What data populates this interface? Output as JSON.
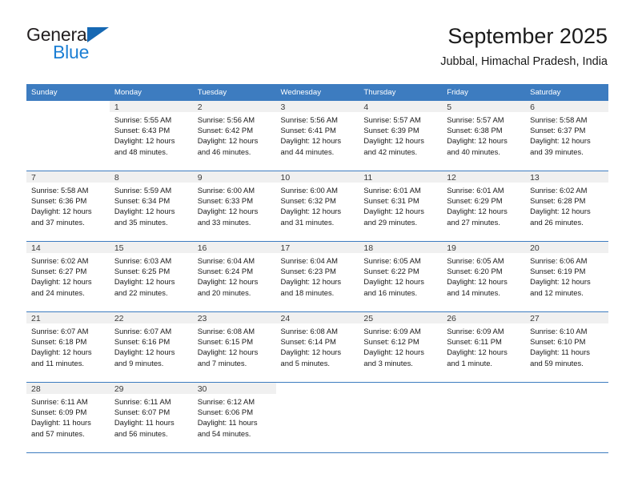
{
  "brand": {
    "line1": "General",
    "line2": "Blue",
    "triangle_color": "#1668b3",
    "line2_color": "#1c7fd4"
  },
  "header": {
    "title": "September 2025",
    "subtitle": "Jubbal, Himachal Pradesh, India"
  },
  "calendar": {
    "header_bg": "#3d7cc0",
    "daynum_bg": "#f0f0f0",
    "weekday_headers": [
      "Sunday",
      "Monday",
      "Tuesday",
      "Wednesday",
      "Thursday",
      "Friday",
      "Saturday"
    ],
    "weeks": [
      [
        {
          "day": "",
          "sunrise": "",
          "sunset": "",
          "daylight1": "",
          "daylight2": ""
        },
        {
          "day": "1",
          "sunrise": "Sunrise: 5:55 AM",
          "sunset": "Sunset: 6:43 PM",
          "daylight1": "Daylight: 12 hours",
          "daylight2": "and 48 minutes."
        },
        {
          "day": "2",
          "sunrise": "Sunrise: 5:56 AM",
          "sunset": "Sunset: 6:42 PM",
          "daylight1": "Daylight: 12 hours",
          "daylight2": "and 46 minutes."
        },
        {
          "day": "3",
          "sunrise": "Sunrise: 5:56 AM",
          "sunset": "Sunset: 6:41 PM",
          "daylight1": "Daylight: 12 hours",
          "daylight2": "and 44 minutes."
        },
        {
          "day": "4",
          "sunrise": "Sunrise: 5:57 AM",
          "sunset": "Sunset: 6:39 PM",
          "daylight1": "Daylight: 12 hours",
          "daylight2": "and 42 minutes."
        },
        {
          "day": "5",
          "sunrise": "Sunrise: 5:57 AM",
          "sunset": "Sunset: 6:38 PM",
          "daylight1": "Daylight: 12 hours",
          "daylight2": "and 40 minutes."
        },
        {
          "day": "6",
          "sunrise": "Sunrise: 5:58 AM",
          "sunset": "Sunset: 6:37 PM",
          "daylight1": "Daylight: 12 hours",
          "daylight2": "and 39 minutes."
        }
      ],
      [
        {
          "day": "7",
          "sunrise": "Sunrise: 5:58 AM",
          "sunset": "Sunset: 6:36 PM",
          "daylight1": "Daylight: 12 hours",
          "daylight2": "and 37 minutes."
        },
        {
          "day": "8",
          "sunrise": "Sunrise: 5:59 AM",
          "sunset": "Sunset: 6:34 PM",
          "daylight1": "Daylight: 12 hours",
          "daylight2": "and 35 minutes."
        },
        {
          "day": "9",
          "sunrise": "Sunrise: 6:00 AM",
          "sunset": "Sunset: 6:33 PM",
          "daylight1": "Daylight: 12 hours",
          "daylight2": "and 33 minutes."
        },
        {
          "day": "10",
          "sunrise": "Sunrise: 6:00 AM",
          "sunset": "Sunset: 6:32 PM",
          "daylight1": "Daylight: 12 hours",
          "daylight2": "and 31 minutes."
        },
        {
          "day": "11",
          "sunrise": "Sunrise: 6:01 AM",
          "sunset": "Sunset: 6:31 PM",
          "daylight1": "Daylight: 12 hours",
          "daylight2": "and 29 minutes."
        },
        {
          "day": "12",
          "sunrise": "Sunrise: 6:01 AM",
          "sunset": "Sunset: 6:29 PM",
          "daylight1": "Daylight: 12 hours",
          "daylight2": "and 27 minutes."
        },
        {
          "day": "13",
          "sunrise": "Sunrise: 6:02 AM",
          "sunset": "Sunset: 6:28 PM",
          "daylight1": "Daylight: 12 hours",
          "daylight2": "and 26 minutes."
        }
      ],
      [
        {
          "day": "14",
          "sunrise": "Sunrise: 6:02 AM",
          "sunset": "Sunset: 6:27 PM",
          "daylight1": "Daylight: 12 hours",
          "daylight2": "and 24 minutes."
        },
        {
          "day": "15",
          "sunrise": "Sunrise: 6:03 AM",
          "sunset": "Sunset: 6:25 PM",
          "daylight1": "Daylight: 12 hours",
          "daylight2": "and 22 minutes."
        },
        {
          "day": "16",
          "sunrise": "Sunrise: 6:04 AM",
          "sunset": "Sunset: 6:24 PM",
          "daylight1": "Daylight: 12 hours",
          "daylight2": "and 20 minutes."
        },
        {
          "day": "17",
          "sunrise": "Sunrise: 6:04 AM",
          "sunset": "Sunset: 6:23 PM",
          "daylight1": "Daylight: 12 hours",
          "daylight2": "and 18 minutes."
        },
        {
          "day": "18",
          "sunrise": "Sunrise: 6:05 AM",
          "sunset": "Sunset: 6:22 PM",
          "daylight1": "Daylight: 12 hours",
          "daylight2": "and 16 minutes."
        },
        {
          "day": "19",
          "sunrise": "Sunrise: 6:05 AM",
          "sunset": "Sunset: 6:20 PM",
          "daylight1": "Daylight: 12 hours",
          "daylight2": "and 14 minutes."
        },
        {
          "day": "20",
          "sunrise": "Sunrise: 6:06 AM",
          "sunset": "Sunset: 6:19 PM",
          "daylight1": "Daylight: 12 hours",
          "daylight2": "and 12 minutes."
        }
      ],
      [
        {
          "day": "21",
          "sunrise": "Sunrise: 6:07 AM",
          "sunset": "Sunset: 6:18 PM",
          "daylight1": "Daylight: 12 hours",
          "daylight2": "and 11 minutes."
        },
        {
          "day": "22",
          "sunrise": "Sunrise: 6:07 AM",
          "sunset": "Sunset: 6:16 PM",
          "daylight1": "Daylight: 12 hours",
          "daylight2": "and 9 minutes."
        },
        {
          "day": "23",
          "sunrise": "Sunrise: 6:08 AM",
          "sunset": "Sunset: 6:15 PM",
          "daylight1": "Daylight: 12 hours",
          "daylight2": "and 7 minutes."
        },
        {
          "day": "24",
          "sunrise": "Sunrise: 6:08 AM",
          "sunset": "Sunset: 6:14 PM",
          "daylight1": "Daylight: 12 hours",
          "daylight2": "and 5 minutes."
        },
        {
          "day": "25",
          "sunrise": "Sunrise: 6:09 AM",
          "sunset": "Sunset: 6:12 PM",
          "daylight1": "Daylight: 12 hours",
          "daylight2": "and 3 minutes."
        },
        {
          "day": "26",
          "sunrise": "Sunrise: 6:09 AM",
          "sunset": "Sunset: 6:11 PM",
          "daylight1": "Daylight: 12 hours",
          "daylight2": "and 1 minute."
        },
        {
          "day": "27",
          "sunrise": "Sunrise: 6:10 AM",
          "sunset": "Sunset: 6:10 PM",
          "daylight1": "Daylight: 11 hours",
          "daylight2": "and 59 minutes."
        }
      ],
      [
        {
          "day": "28",
          "sunrise": "Sunrise: 6:11 AM",
          "sunset": "Sunset: 6:09 PM",
          "daylight1": "Daylight: 11 hours",
          "daylight2": "and 57 minutes."
        },
        {
          "day": "29",
          "sunrise": "Sunrise: 6:11 AM",
          "sunset": "Sunset: 6:07 PM",
          "daylight1": "Daylight: 11 hours",
          "daylight2": "and 56 minutes."
        },
        {
          "day": "30",
          "sunrise": "Sunrise: 6:12 AM",
          "sunset": "Sunset: 6:06 PM",
          "daylight1": "Daylight: 11 hours",
          "daylight2": "and 54 minutes."
        },
        {
          "day": "",
          "sunrise": "",
          "sunset": "",
          "daylight1": "",
          "daylight2": ""
        },
        {
          "day": "",
          "sunrise": "",
          "sunset": "",
          "daylight1": "",
          "daylight2": ""
        },
        {
          "day": "",
          "sunrise": "",
          "sunset": "",
          "daylight1": "",
          "daylight2": ""
        },
        {
          "day": "",
          "sunrise": "",
          "sunset": "",
          "daylight1": "",
          "daylight2": ""
        }
      ]
    ]
  }
}
